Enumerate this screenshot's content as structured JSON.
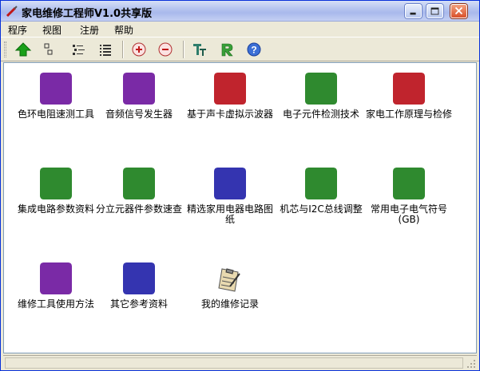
{
  "window": {
    "title": "家电维修工程师V1.0共享版"
  },
  "menu": [
    {
      "label": "程序"
    },
    {
      "label": "视图"
    },
    {
      "label": "注册"
    },
    {
      "label": "帮助"
    }
  ],
  "toolbar_icons": [
    "up-arrow-icon",
    "large-icons-view-icon",
    "list-view-icon",
    "details-view-icon",
    "zoom-in-icon",
    "zoom-out-icon",
    "font-icon",
    "register-icon",
    "help-icon"
  ],
  "items": [
    {
      "label": "色环电阻速测工具",
      "icon": "multimeter-icon",
      "badge": "#7a2aa6"
    },
    {
      "label": "音频信号发生器",
      "icon": "signal-generator-icon",
      "badge": "#7a2aa6"
    },
    {
      "label": "基于声卡虚拟示波器",
      "icon": "oscilloscope-icon",
      "badge": "#c0242d"
    },
    {
      "label": "电子元件检测技术",
      "icon": "component-tester-icon",
      "badge": "#2f8a2f"
    },
    {
      "label": "家电工作原理与检修",
      "icon": "tv-repair-icon",
      "badge": "#c0242d"
    },
    {
      "label": "集成电路参数资料",
      "icon": "ic-chip-icon",
      "badge": "#2f8a2f"
    },
    {
      "label": "分立元器件参数速查",
      "icon": "parts-list-icon",
      "badge": "#2f8a2f"
    },
    {
      "label": "精选家用电器电路图纸",
      "icon": "circuit-diagram-icon",
      "badge": "#3434b0"
    },
    {
      "label": "机芯与I2C总线调整",
      "icon": "i2c-chip-icon",
      "badge": "#2f8a2f"
    },
    {
      "label": "常用电子电气符号(GB)",
      "icon": "symbols-icon",
      "badge": "#2f8a2f"
    },
    {
      "label": "维修工具使用方法",
      "icon": "repair-tools-icon",
      "badge": "#7a2aa6"
    },
    {
      "label": "其它参考资料",
      "icon": "reference-book-icon",
      "badge": "#3434b0"
    },
    {
      "label": "我的维修记录",
      "icon": "clipboard-icon",
      "badge": ""
    }
  ],
  "colors": {
    "accent": "#0831d9",
    "background": "#ece9d8",
    "content_bg": "#ffffff"
  }
}
